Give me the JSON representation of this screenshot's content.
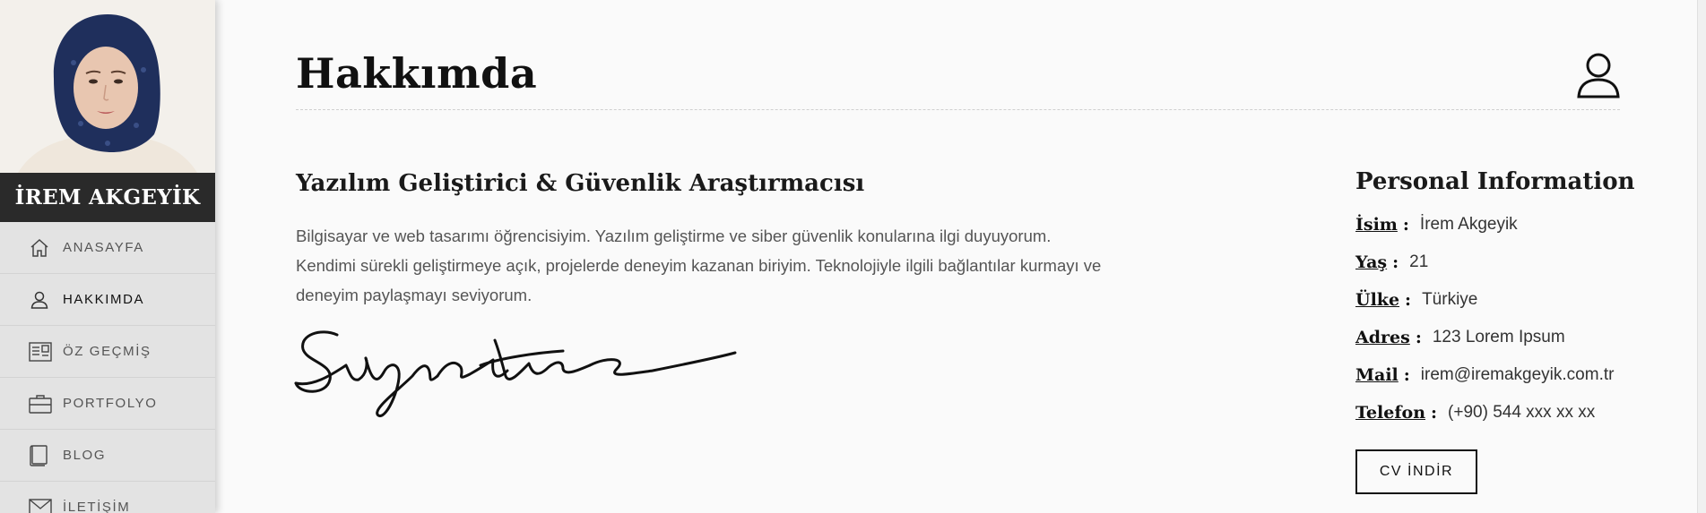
{
  "sidebar": {
    "name": "İREM AKGEYİK",
    "items": [
      {
        "label": "ANASAYFA",
        "icon": "home-icon"
      },
      {
        "label": "HAKKIMDA",
        "icon": "user-icon"
      },
      {
        "label": "ÖZ GEÇMİŞ",
        "icon": "resume-icon"
      },
      {
        "label": "PORTFOLYO",
        "icon": "briefcase-icon"
      },
      {
        "label": "BLOG",
        "icon": "book-icon"
      },
      {
        "label": "İLETİŞİM",
        "icon": "mail-icon"
      }
    ],
    "active_index": 1
  },
  "main": {
    "title": "Hakkımda",
    "subtitle": "Yazılım Geliştirici & Güvenlik Araştırmacısı",
    "bio": [
      "Bilgisayar ve web tasarımı öğrencisiyim. Yazılım geliştirme ve siber güvenlik konularına ilgi duyuyorum.",
      "Kendimi sürekli geliştirmeye açık, projelerde deneyim kazanan biriyim. Teknolojiyle ilgili bağlantılar kurmayı ve",
      "deneyim paylaşmayı seviyorum."
    ],
    "signature_text": "Signature"
  },
  "info": {
    "title": "Personal Information",
    "rows": [
      {
        "key": "İsim",
        "value": "İrem Akgeyik"
      },
      {
        "key": "Yaş",
        "value": "21"
      },
      {
        "key": "Ülke",
        "value": "Türkiye"
      },
      {
        "key": "Adres",
        "value": "123 Lorem Ipsum"
      },
      {
        "key": "Mail",
        "value": "irem@iremakgeyik.com.tr"
      },
      {
        "key": "Telefon",
        "value": "(+90) 544 xxx xx xx"
      }
    ],
    "cv_button": "CV İNDİR"
  },
  "colors": {
    "sidebar_bg": "#e3e3e3",
    "name_banner_bg": "#2a2a2a",
    "main_bg": "#fafafa",
    "hijab": "#1f2f5c"
  }
}
